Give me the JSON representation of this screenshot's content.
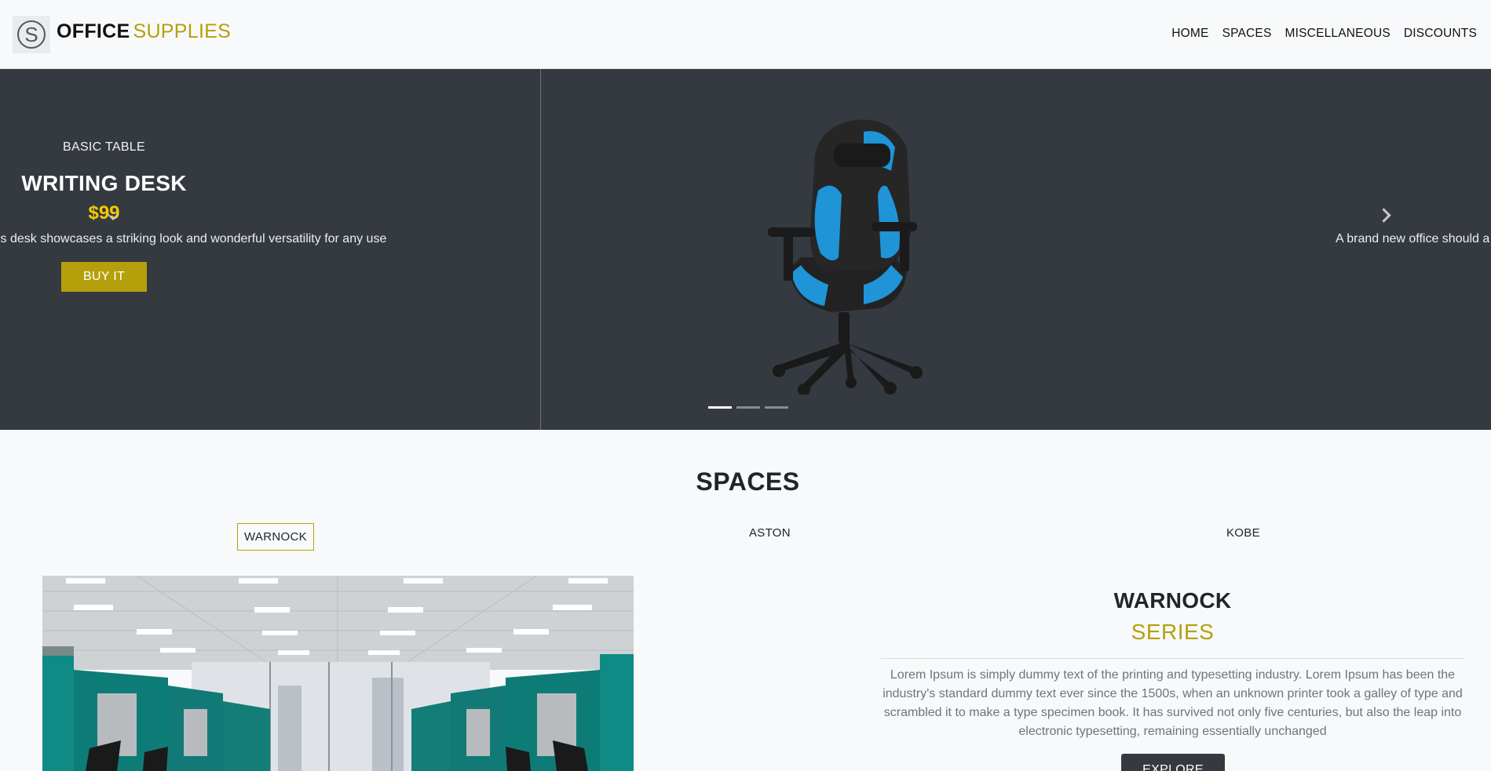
{
  "header": {
    "logo_letter": "S",
    "brand_part1": "OFFICE",
    "brand_part2": "SUPPLIES",
    "nav": [
      "HOME",
      "SPACES",
      "MISCELLANEOUS",
      "DISCOUNTS"
    ]
  },
  "carousel": {
    "slide": {
      "category": "BASIC TABLE",
      "title": "WRITING DESK",
      "price": "$99",
      "description": "is desk showcases a striking look and wonderful versatility for any use",
      "button": "BUY IT"
    },
    "next_slide_description": "A brand new office should a",
    "indicator_count": 3,
    "active_indicator": 0
  },
  "spaces": {
    "title": "SPACES",
    "tabs": [
      "WARNOCK",
      "ASTON",
      "KOBE"
    ],
    "active_tab": "WARNOCK",
    "series_name": "WARNOCK",
    "series_label": "SERIES",
    "description": "Lorem Ipsum is simply dummy text of the printing and typesetting industry. Lorem Ipsum has been the industry's standard dummy text ever since the 1500s, when an unknown printer took a galley of type and scrambled it to make a type specimen book. It has survived not only five centuries, but also the leap into electronic typesetting, remaining essentially unchanged",
    "button": "EXPLORE"
  },
  "colors": {
    "accent": "#b5a00c",
    "dark": "#343a40",
    "price": "#f5c800",
    "background": "#f8f9fa"
  }
}
